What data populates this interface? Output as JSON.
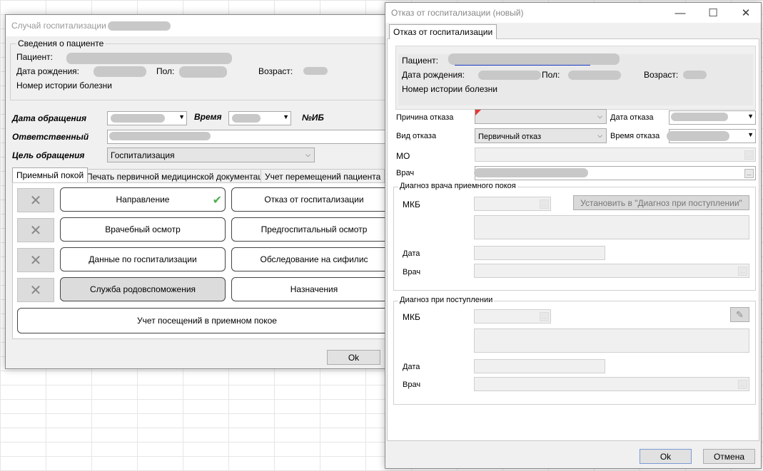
{
  "win1": {
    "title": "Случай госпитализации",
    "patient_group": "Сведения о пациенте",
    "patient_label": "Пациент:",
    "dob_label": "Дата рождения:",
    "sex_label": "Пол:",
    "age_label": "Возраст:",
    "history_label": "Номер истории болезни",
    "visit_date_label": "Дата обращения",
    "time_label": "Время",
    "ib_label": "№ИБ",
    "responsible_label": "Ответственный",
    "purpose_label": "Цель обращения",
    "purpose_value": "Госпитализация",
    "tabs": [
      "Приемный покой",
      "Печать первичной медицинской документации",
      "Учет перемещений пациента"
    ],
    "buttons": {
      "direction": "Направление",
      "refusal": "Отказ от госпитализации",
      "exam": "Врачебный осмотр",
      "pre_exam": "Предгоспитальный осмотр",
      "hosp_data": "Данные по госпитализации",
      "syphilis": "Обследование на сифилис",
      "obstetric": "Служба родовспоможения",
      "prescriptions": "Назначения",
      "visits": "Учет посещений в приемном покое"
    },
    "ok": "Ok",
    "cross_glyph": "✕",
    "check_glyph": "✔"
  },
  "win2": {
    "title": "Отказ от госпитализации (новый)",
    "tab": "Отказ от госпитализации",
    "patient_label": "Пациент:",
    "dob_label": "Дата рождения:",
    "sex_label": "Пол:",
    "age_label": "Возраст:",
    "history_label": "Номер истории болезни",
    "reason_label": "Причина отказа",
    "refusal_date_label": "Дата отказа",
    "refusal_type_label": "Вид отказа",
    "refusal_type_value": "Первичный отказ",
    "refusal_time_label": "Время отказа",
    "mo_label": "МО",
    "doctor_label": "Врач",
    "er_diag_group": "Диагноз врача приемного покоя",
    "mkb_label": "МКБ",
    "set_button": "Установить в \"Диагноз при поступлении\"",
    "date_label": "Дата",
    "admission_diag_group": "Диагноз при поступлении",
    "ok": "Ok",
    "cancel": "Отмена",
    "dots": "...",
    "minimize": "—",
    "maximize": "☐",
    "close": "✕"
  },
  "colors": {
    "window_bg": "#f0f0f0",
    "redaction": "#c8c8c8",
    "check_green": "#4caf50",
    "required_flag": "#e53935",
    "link_blue": "#1a3cc8"
  }
}
